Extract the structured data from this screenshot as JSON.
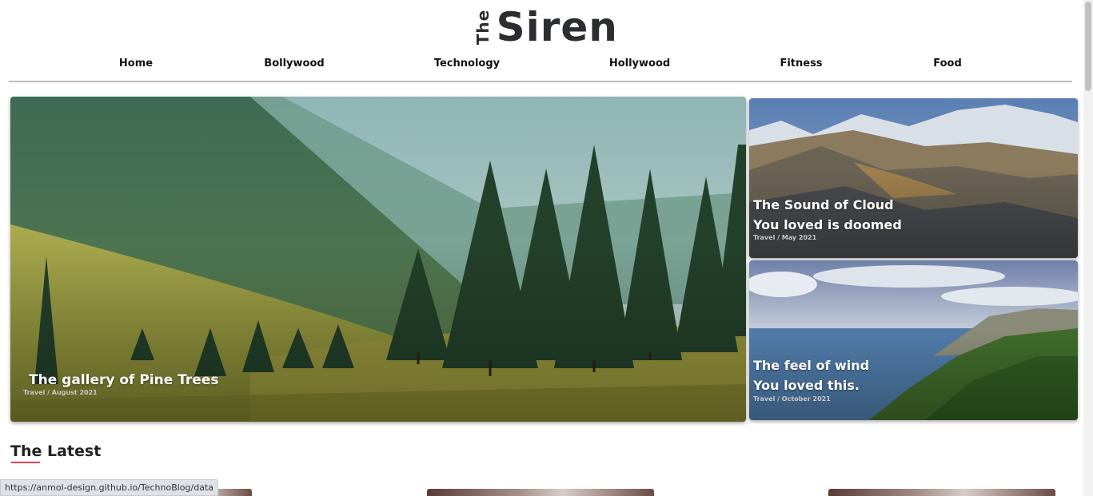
{
  "brand": {
    "the": "The",
    "name": "Siren"
  },
  "nav": [
    "Home",
    "Bollywood",
    "Technology",
    "Hollywood",
    "Fitness",
    "Food"
  ],
  "featured": {
    "main": {
      "title": "The gallery of Pine Trees",
      "meta": "Travel / August 2021"
    },
    "side1": {
      "title_line1": "The Sound of Cloud",
      "title_line2": "You loved is doomed",
      "meta": "Travel / May 2021"
    },
    "side2": {
      "title_line1": "The feel of wind",
      "title_line2": "You loved this.",
      "meta": "Travel / October 2021"
    }
  },
  "section": {
    "latest": "The Latest"
  },
  "status_url": "https://anmol-design.github.io/TechnoBlog/data",
  "colors": {
    "accent": "#e0434f",
    "brand_text": "#2b2d33"
  }
}
